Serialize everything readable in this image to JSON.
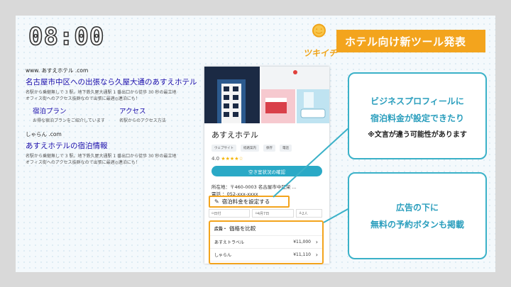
{
  "clock": "08:00",
  "brand": {
    "label": "ツキイチ"
  },
  "banner": "ホテル向け新ツール発表",
  "serp": {
    "ad1": {
      "url": "www. あすえホテル .com",
      "title": "名古屋市中区への出張なら久屋大通のあすえホテル",
      "desc_1": "名駅から乗継無しで 3 駅。地下鉄久屋大通駅 1 番出口から徒歩 30 秒の最立地",
      "desc_2": "オフィス街へのアクセス抜群なので出張に最適◎連泊にも！",
      "sitelinks": [
        {
          "title": "宿泊プラン",
          "desc": "お得な宿泊プランをご紹介しています"
        },
        {
          "title": "アクセス",
          "desc": "名駅からのアクセス方法"
        }
      ]
    },
    "ad2": {
      "url": "しゃらん .com",
      "title": "あすえホテルの宿泊情報",
      "desc_1": "名駅から乗継無しで 3 駅。地下鉄久屋大通駅 1 番出口から徒歩 30 秒の最立地",
      "desc_2": "オフィス街へのアクセス抜群なので出張に最適◎連泊にも！"
    }
  },
  "card": {
    "name": "あすえホテル",
    "chips": [
      "ウェブサイト",
      "経路案内",
      "保存",
      "電話"
    ],
    "rating": "4.0",
    "stars": "★★★★☆",
    "cta": "空き室状況の確認",
    "address": "所在地：〒460-0003 名古屋市中区栄 ...",
    "phone": "電話 ：052-xxx-xxxx",
    "rate_link": "宿泊料金を設定する",
    "booking": [
      "日付",
      "4月7日",
      "2人"
    ],
    "prices_header_tag": "広告・",
    "prices_header": "価格を比較",
    "prices": [
      {
        "site": "あすえトラベル",
        "price": "¥11,000"
      },
      {
        "site": "しゃらん",
        "price": "¥11,110"
      }
    ]
  },
  "callout1": {
    "line1": "ビジネスプロフィールに",
    "line2": "宿泊料金が設定できたり",
    "note": "※文言が違う可能性があります"
  },
  "callout2": {
    "line1": "広告の下に",
    "line2": "無料の予約ボタンも掲載"
  },
  "colors": {
    "accent_orange": "#f3a41d",
    "accent_teal": "#3ab1c8",
    "link_blue": "#1a0dab"
  }
}
